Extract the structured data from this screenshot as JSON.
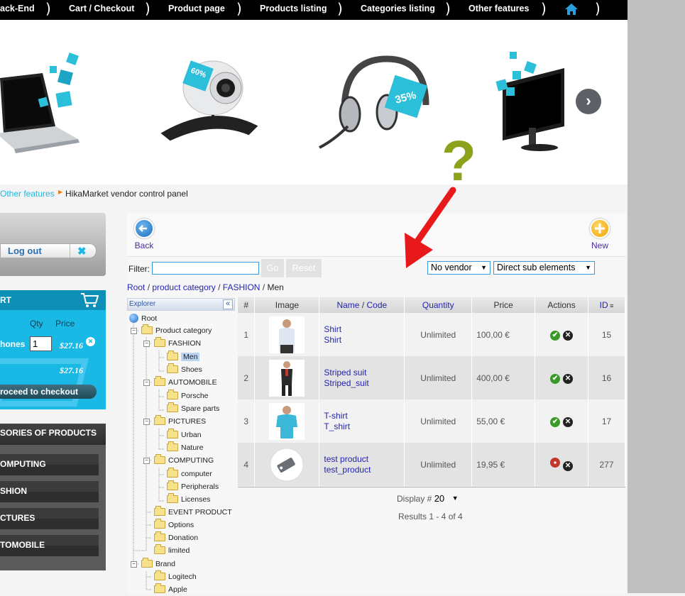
{
  "topnav": {
    "items": [
      "ack-End",
      "Cart / Checkout",
      "Product page",
      "Products listing",
      "Categories listing",
      "Other features"
    ],
    "separator": ")",
    "home_icon": "home-icon"
  },
  "banner": {
    "badges": [
      "60%",
      "35%"
    ],
    "help_mark": "?",
    "next_icon": "chevron-right-icon"
  },
  "breadcrumb": {
    "link": "Other features",
    "current": "HikaMarket vendor control panel"
  },
  "login": {
    "logout_label": "Log out"
  },
  "cart": {
    "title": "RT",
    "col_qty": "Qty",
    "col_price": "Price",
    "item_name": "hones",
    "item_qty": "1",
    "item_price": "$27.16",
    "total": "$27.16",
    "checkout_label": "roceed to checkout"
  },
  "categories": {
    "title": "SORIES OF PRODUCTS",
    "items": [
      "OMPUTING",
      "SHION",
      "CTURES",
      "TOMOBILE"
    ]
  },
  "toolbar": {
    "back_label": "Back",
    "new_label": "New"
  },
  "filter": {
    "label": "Filter:",
    "value": "",
    "go_label": "Go",
    "reset_label": "Reset",
    "vendor_select": "No vendor",
    "scope_select": "Direct sub elements"
  },
  "path": {
    "root": "Root",
    "sep": " / ",
    "category": "product category",
    "sub": "FASHION",
    "current": "Men"
  },
  "explorer": {
    "title": "Explorer",
    "collapse": "«",
    "nodes": [
      "Root",
      "Product category",
      "FASHION",
      "Men",
      "Shoes",
      "AUTOMOBILE",
      "Porsche",
      "Spare parts",
      "PICTURES",
      "Urban",
      "Nature",
      "COMPUTING",
      "computer",
      "Peripherals",
      "Licenses",
      "EVENT PRODUCT",
      "Options",
      "Donation",
      "limited",
      "Brand",
      "Logitech",
      "Apple"
    ]
  },
  "grid": {
    "headers": {
      "num": "#",
      "image": "Image",
      "name": "Name",
      "slash": " / ",
      "code": "Code",
      "quantity": "Quantity",
      "price": "Price",
      "actions": "Actions",
      "id": "ID"
    },
    "rows": [
      {
        "num": "1",
        "name": "Shirt",
        "code": "Shirt",
        "quantity": "Unlimited",
        "price": "100,00 €",
        "published": true,
        "id": "15"
      },
      {
        "num": "2",
        "name": "Striped suit",
        "code": "Striped_suit",
        "quantity": "Unlimited",
        "price": "400,00 €",
        "published": true,
        "id": "16"
      },
      {
        "num": "3",
        "name": "T-shirt",
        "code": "T_shirt",
        "quantity": "Unlimited",
        "price": "55,00 €",
        "published": true,
        "id": "17"
      },
      {
        "num": "4",
        "name": "test product",
        "code": "test_product",
        "quantity": "Unlimited",
        "price": "19,95 €",
        "published": false,
        "id": "277"
      }
    ],
    "display_label": "Display #",
    "display_value": "20",
    "results": "Results 1 - 4 of 4"
  },
  "colors": {
    "accent": "#1ab8e5",
    "link": "#2424b0",
    "publish": "#3a9a28",
    "unpublish": "#c0392b",
    "arrow": "#e8191b",
    "help": "#8aa31a"
  }
}
